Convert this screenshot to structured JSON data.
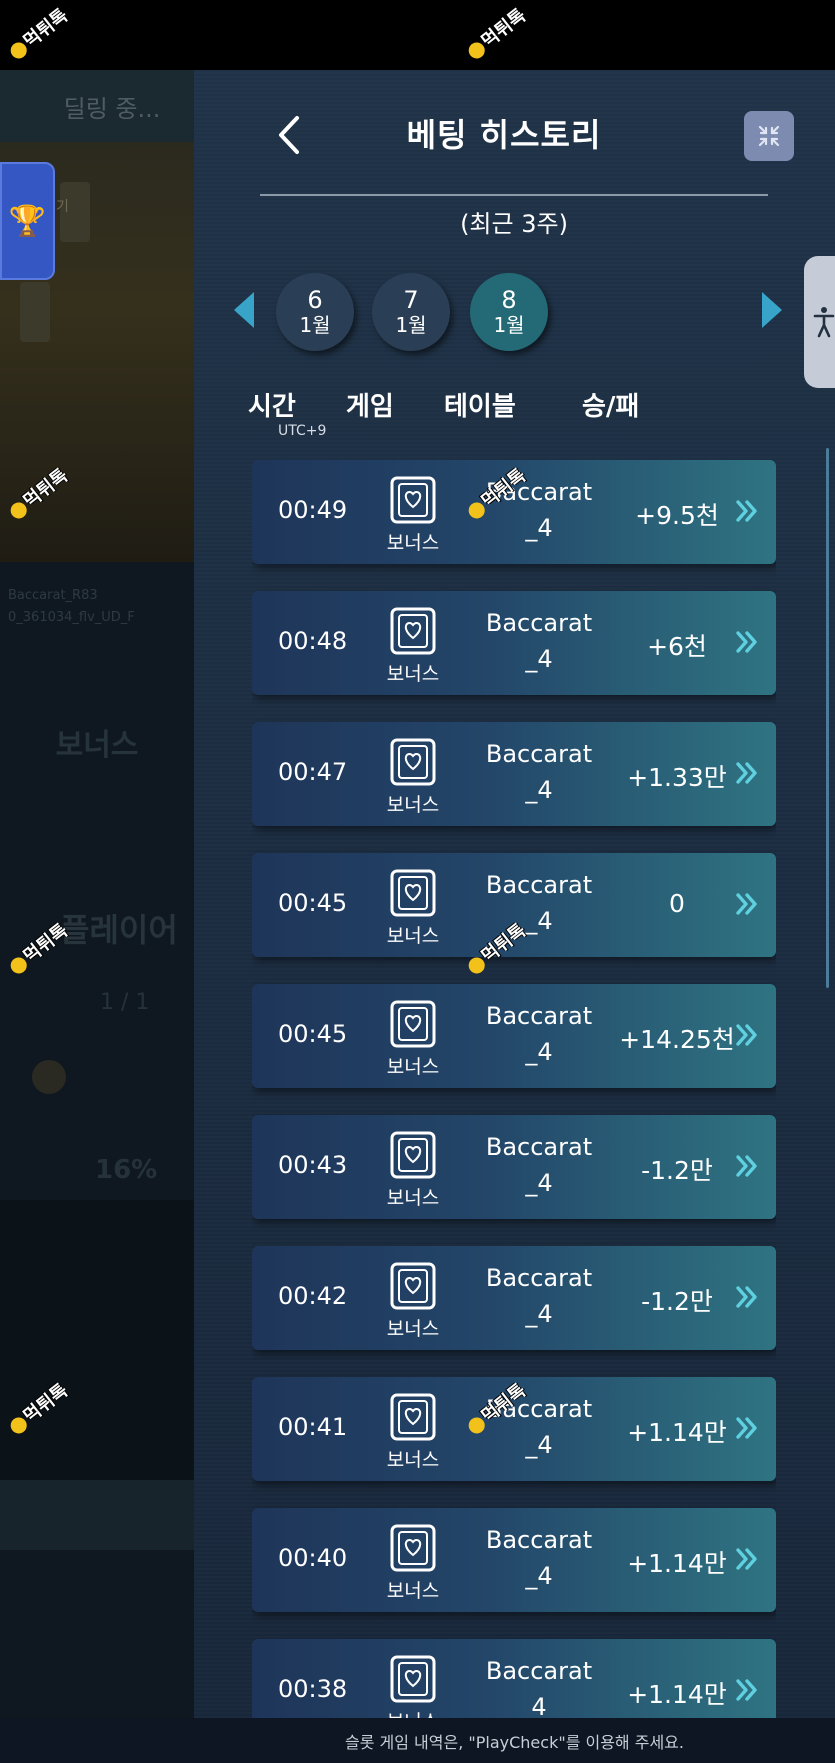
{
  "background": {
    "dealing_label": "딜링 중...",
    "scroll_text": "기",
    "table_info": [
      "Baccarat_R83",
      "0_361034_flv_UD_F"
    ],
    "bonus_label": "보너스",
    "player_label": "플레이어",
    "ratio": "1 / 1",
    "percent": "16%"
  },
  "panel": {
    "title": "베팅 히스토리",
    "subtitle": "(최근 3주)",
    "days": [
      {
        "day": "6",
        "month": "1월",
        "selected": false
      },
      {
        "day": "7",
        "month": "1월",
        "selected": false
      },
      {
        "day": "8",
        "month": "1월",
        "selected": true
      }
    ],
    "columns": {
      "time": "시간",
      "time_zone": "UTC+9",
      "game": "게임",
      "table": "테이블",
      "result": "승/패"
    },
    "rows": [
      {
        "time": "00:49",
        "game": "보너스",
        "table_line1": "Baccarat",
        "table_line2": "_4",
        "result": "+9.5천"
      },
      {
        "time": "00:48",
        "game": "보너스",
        "table_line1": "Baccarat",
        "table_line2": "_4",
        "result": "+6천"
      },
      {
        "time": "00:47",
        "game": "보너스",
        "table_line1": "Baccarat",
        "table_line2": "_4",
        "result": "+1.33만"
      },
      {
        "time": "00:45",
        "game": "보너스",
        "table_line1": "Baccarat",
        "table_line2": "_4",
        "result": "0"
      },
      {
        "time": "00:45",
        "game": "보너스",
        "table_line1": "Baccarat",
        "table_line2": "_4",
        "result": "+14.25천"
      },
      {
        "time": "00:43",
        "game": "보너스",
        "table_line1": "Baccarat",
        "table_line2": "_4",
        "result": "-1.2만"
      },
      {
        "time": "00:42",
        "game": "보너스",
        "table_line1": "Baccarat",
        "table_line2": "_4",
        "result": "-1.2만"
      },
      {
        "time": "00:41",
        "game": "보너스",
        "table_line1": "Baccarat",
        "table_line2": "_4",
        "result": "+1.14만"
      },
      {
        "time": "00:40",
        "game": "보너스",
        "table_line1": "Baccarat",
        "table_line2": "_4",
        "result": "+1.14만"
      },
      {
        "time": "00:38",
        "game": "보너스",
        "table_line1": "Baccarat",
        "table_line2": "4",
        "result": "+1.14만"
      }
    ],
    "footer_note": "슬롯 게임 내역은, \"PlayCheck\"를 이용해 주세요."
  },
  "watermark_text": "먹튀톡",
  "colors": {
    "panel_bg": "#1f3247",
    "accent_arrow": "#39a4c9",
    "selected_day": "#236a76",
    "chevron": "#5fd0e0",
    "collapse_button": "#7d8bb0"
  },
  "icons": {
    "back": "chevron-left-icon",
    "collapse": "collapse-arrows-icon",
    "game": "card-heart-icon",
    "row_action": "double-chevron-right-icon",
    "accessibility": "accessibility-person-icon",
    "trophy": "trophy-icon"
  }
}
